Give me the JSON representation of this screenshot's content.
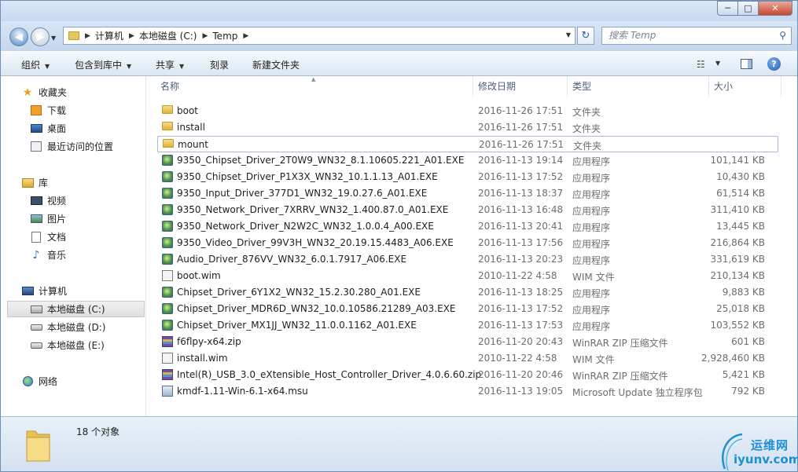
{
  "window": {
    "minimize": "─",
    "maximize": "□",
    "close": "✕"
  },
  "address": {
    "crumbs": [
      "计算机",
      "本地磁盘 (C:)",
      "Temp"
    ],
    "search_placeholder": "搜索 Temp"
  },
  "toolbar": {
    "organize": "组织",
    "include_in_library": "包含到库中",
    "share": "共享",
    "burn": "刻录",
    "new_folder": "新建文件夹"
  },
  "sidebar": {
    "favorites": "收藏夹",
    "downloads": "下载",
    "desktop": "桌面",
    "recent": "最近访问的位置",
    "libraries": "库",
    "videos": "视频",
    "pictures": "图片",
    "documents": "文档",
    "music": "音乐",
    "computer": "计算机",
    "drive_c": "本地磁盘 (C:)",
    "drive_d": "本地磁盘 (D:)",
    "drive_e": "本地磁盘 (E:)",
    "network": "网络"
  },
  "columns": {
    "name": "名称",
    "modified": "修改日期",
    "type": "类型",
    "size": "大小"
  },
  "files": [
    {
      "name": "boot",
      "date": "2016-11-26 17:51",
      "type": "文件夹",
      "size": "",
      "icon": "folder-icon"
    },
    {
      "name": "install",
      "date": "2016-11-26 17:51",
      "type": "文件夹",
      "size": "",
      "icon": "folder-icon"
    },
    {
      "name": "mount",
      "date": "2016-11-26 17:51",
      "type": "文件夹",
      "size": "",
      "icon": "folder-icon"
    },
    {
      "name": "9350_Chipset_Driver_2T0W9_WN32_8.1.10605.221_A01.EXE",
      "date": "2016-11-13 19:14",
      "type": "应用程序",
      "size": "101,141 KB",
      "icon": "exe-icon"
    },
    {
      "name": "9350_Chipset_Driver_P1X3X_WN32_10.1.1.13_A01.EXE",
      "date": "2016-11-13 17:52",
      "type": "应用程序",
      "size": "10,430 KB",
      "icon": "exe-icon"
    },
    {
      "name": "9350_Input_Driver_377D1_WN32_19.0.27.6_A01.EXE",
      "date": "2016-11-13 18:37",
      "type": "应用程序",
      "size": "61,514 KB",
      "icon": "exe-icon"
    },
    {
      "name": "9350_Network_Driver_7XRRV_WN32_1.400.87.0_A01.EXE",
      "date": "2016-11-13 16:48",
      "type": "应用程序",
      "size": "311,410 KB",
      "icon": "exe-icon"
    },
    {
      "name": "9350_Network_Driver_N2W2C_WN32_1.0.0.4_A00.EXE",
      "date": "2016-11-13 20:41",
      "type": "应用程序",
      "size": "13,445 KB",
      "icon": "exe-icon"
    },
    {
      "name": "9350_Video_Driver_99V3H_WN32_20.19.15.4483_A06.EXE",
      "date": "2016-11-13 17:56",
      "type": "应用程序",
      "size": "216,864 KB",
      "icon": "exe-icon"
    },
    {
      "name": "Audio_Driver_876VV_WN32_6.0.1.7917_A06.EXE",
      "date": "2016-11-13 20:23",
      "type": "应用程序",
      "size": "331,619 KB",
      "icon": "exe-icon"
    },
    {
      "name": "boot.wim",
      "date": "2010-11-22 4:58",
      "type": "WIM 文件",
      "size": "210,134 KB",
      "icon": "wim-icon"
    },
    {
      "name": "Chipset_Driver_6Y1X2_WN32_15.2.30.280_A01.EXE",
      "date": "2016-11-13 18:25",
      "type": "应用程序",
      "size": "9,883 KB",
      "icon": "exe-icon"
    },
    {
      "name": "Chipset_Driver_MDR6D_WN32_10.0.10586.21289_A03.EXE",
      "date": "2016-11-13 17:52",
      "type": "应用程序",
      "size": "25,018 KB",
      "icon": "exe-icon"
    },
    {
      "name": "Chipset_Driver_MX1JJ_WN32_11.0.0.1162_A01.EXE",
      "date": "2016-11-13 17:53",
      "type": "应用程序",
      "size": "103,552 KB",
      "icon": "exe-icon"
    },
    {
      "name": "f6flpy-x64.zip",
      "date": "2016-11-20 20:43",
      "type": "WinRAR ZIP 压缩文件",
      "size": "601 KB",
      "icon": "zip-icon"
    },
    {
      "name": "install.wim",
      "date": "2010-11-22 4:58",
      "type": "WIM 文件",
      "size": "2,928,460 KB",
      "icon": "wim-icon"
    },
    {
      "name": "Intel(R)_USB_3.0_eXtensible_Host_Controller_Driver_4.0.6.60.zip",
      "date": "2016-11-20 20:46",
      "type": "WinRAR ZIP 压缩文件",
      "size": "5,421 KB",
      "icon": "zip-icon"
    },
    {
      "name": "kmdf-1.11-Win-6.1-x64.msu",
      "date": "2016-11-13 19:05",
      "type": "Microsoft Update 独立程序包",
      "size": "792 KB",
      "icon": "msu-icon"
    }
  ],
  "status": {
    "item_count": "18 个对象"
  },
  "watermark": {
    "line1": "运维网",
    "line2": "iyunv.com"
  }
}
